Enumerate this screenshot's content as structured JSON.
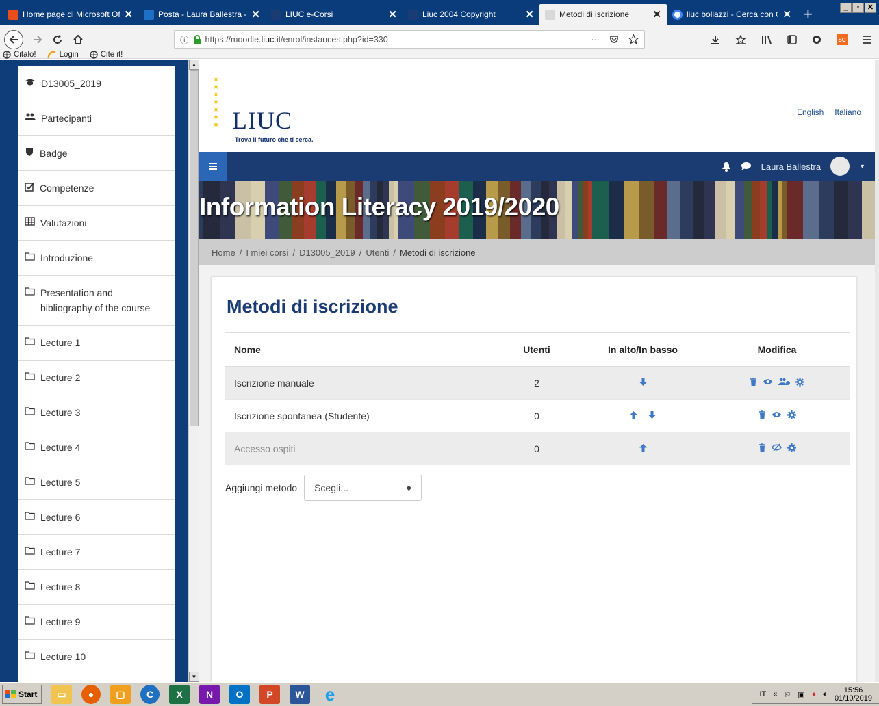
{
  "browser": {
    "tabs": [
      {
        "title": "Home page di Microsoft Off",
        "color": "#e94d1b"
      },
      {
        "title": "Posta - Laura Ballestra - O",
        "color": "#1f6fc6"
      },
      {
        "title": "LIUC e-Corsi",
        "color": "#1b3c73"
      },
      {
        "title": "Liuc 2004 Copyright",
        "color": "#1b3c73"
      },
      {
        "title": "Metodi di iscrizione",
        "color": "#e9e9e9"
      },
      {
        "title": "liuc bollazzi - Cerca con Goo",
        "color": "#4285f4"
      }
    ],
    "url_prefix": "https://moodle.",
    "url_host": "liuc.it",
    "url_path": "/enrol/instances.php?id=330",
    "bookmarks": [
      "Citalo!",
      "Login",
      "Cite it!"
    ],
    "url_more": "···"
  },
  "drawer": {
    "items": [
      {
        "label": "D13005_2019",
        "icon": "graduation-cap-icon"
      },
      {
        "label": "Partecipanti",
        "icon": "users-icon"
      },
      {
        "label": "Badge",
        "icon": "shield-icon"
      },
      {
        "label": "Competenze",
        "icon": "checkbox-icon"
      },
      {
        "label": "Valutazioni",
        "icon": "table-icon"
      },
      {
        "label": "Introduzione",
        "icon": "folder-icon"
      },
      {
        "label": "Presentation and bibliography of the course",
        "icon": "folder-icon"
      },
      {
        "label": "Lecture 1",
        "icon": "folder-icon"
      },
      {
        "label": "Lecture 2",
        "icon": "folder-icon"
      },
      {
        "label": "Lecture 3",
        "icon": "folder-icon"
      },
      {
        "label": "Lecture 4",
        "icon": "folder-icon"
      },
      {
        "label": "Lecture 5",
        "icon": "folder-icon"
      },
      {
        "label": "Lecture 6",
        "icon": "folder-icon"
      },
      {
        "label": "Lecture 7",
        "icon": "folder-icon"
      },
      {
        "label": "Lecture 8",
        "icon": "folder-icon"
      },
      {
        "label": "Lecture 9",
        "icon": "folder-icon"
      },
      {
        "label": "Lecture 10",
        "icon": "folder-icon"
      }
    ]
  },
  "header": {
    "logo_name": "LIUC",
    "logo_tagline": "Trova il futuro che ti cerca.",
    "lang": [
      "English",
      "Italiano"
    ],
    "user_name": "Laura Ballestra",
    "course_title": "Information Literacy 2019/2020"
  },
  "breadcrumb": [
    "Home",
    "I miei corsi",
    "D13005_2019",
    "Utenti",
    "Metodi di iscrizione"
  ],
  "content": {
    "title": "Metodi di iscrizione",
    "columns": [
      "Nome",
      "Utenti",
      "In alto/In basso",
      "Modifica"
    ],
    "rows": [
      {
        "name": "Iscrizione manuale",
        "users": "2",
        "up": false,
        "down": true,
        "actions": [
          "delete-icon",
          "eye-icon",
          "enrol-users-icon",
          "gear-icon"
        ],
        "enabled": true
      },
      {
        "name": "Iscrizione spontanea (Studente)",
        "users": "0",
        "up": true,
        "down": true,
        "actions": [
          "delete-icon",
          "eye-icon",
          "gear-icon"
        ],
        "enabled": true
      },
      {
        "name": "Accesso ospiti",
        "users": "0",
        "up": true,
        "down": false,
        "actions": [
          "delete-icon",
          "eye-slash-icon",
          "gear-icon"
        ],
        "enabled": false
      }
    ],
    "add_label": "Aggiungi metodo",
    "add_select_value": "Scegli..."
  },
  "taskbar": {
    "start": "Start",
    "lang": "IT",
    "time": "15:56",
    "date": "01/10/2019"
  },
  "colors": {
    "brand": "#1b3c73",
    "accent": "#2b66b7",
    "icon": "#3f78c4"
  }
}
